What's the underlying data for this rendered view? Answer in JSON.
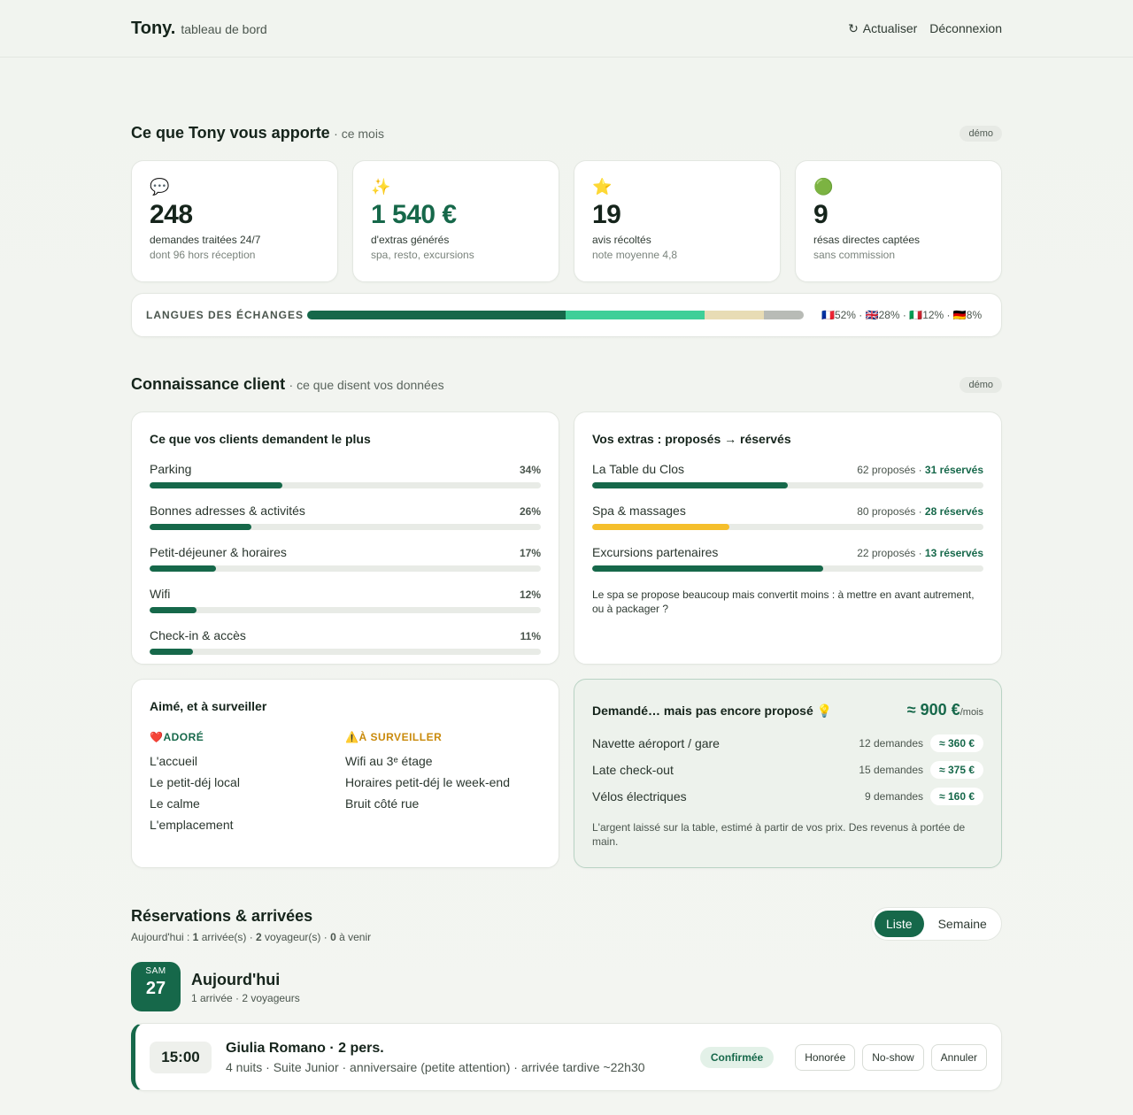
{
  "header": {
    "brand": "Tony.",
    "subtitle": "tableau de bord",
    "refresh": "Actualiser",
    "logout": "Déconnexion"
  },
  "impact": {
    "title": "Ce que Tony vous apporte",
    "subtitle": "· ce mois",
    "badge": "démo",
    "kpis": [
      {
        "emoji": "💬",
        "value": "248",
        "label": "demandes traitées 24/7",
        "note": "dont 96 hors réception"
      },
      {
        "emoji": "✨",
        "value": "1 540 €",
        "label": "d'extras générés",
        "note": "spa, resto, excursions"
      },
      {
        "emoji": "⭐",
        "value": "19",
        "label": "avis récoltés",
        "note": "note moyenne 4,8"
      },
      {
        "emoji": "🟢",
        "value": "9",
        "label": "résas directes captées",
        "note": "sans commission"
      }
    ],
    "languages": {
      "title": "LANGUES DES ÉCHANGES",
      "legend": "🇫🇷52% · 🇬🇧28% · 🇮🇹12% · 🇩🇪8%",
      "shares": [
        52,
        28,
        12,
        8
      ],
      "colors": [
        "#16684a",
        "#3ecf98",
        "#e8dcb5",
        "#b8bbb6"
      ]
    }
  },
  "insight": {
    "title": "Connaissance client",
    "subtitle": "· ce que disent vos données",
    "badge": "démo",
    "requests": {
      "title": "Ce que vos clients demandent le plus",
      "items": [
        {
          "label": "Parking",
          "pct": "34%",
          "value": 34
        },
        {
          "label": "Bonnes adresses & activités",
          "pct": "26%",
          "value": 26
        },
        {
          "label": "Petit-déjeuner & horaires",
          "pct": "17%",
          "value": 17
        },
        {
          "label": "Wifi",
          "pct": "12%",
          "value": 12
        },
        {
          "label": "Check-in & accès",
          "pct": "11%",
          "value": 11
        }
      ]
    },
    "extras": {
      "title": "Vos extras : proposés → réservés",
      "items": [
        {
          "label": "La Table du Clos",
          "offered": "62 proposés · ",
          "booked": "31 réservés",
          "ratio": 0.5,
          "color": "#16684a"
        },
        {
          "label": "Spa & massages",
          "offered": "80 proposés · ",
          "booked": "28 réservés",
          "ratio": 0.35,
          "color": "#f5bf2c"
        },
        {
          "label": "Excursions partenaires",
          "offered": "22 proposés · ",
          "booked": "13 réservés",
          "ratio": 0.59,
          "color": "#16684a"
        }
      ],
      "note": "Le spa se propose beaucoup mais convertit moins : à mettre en avant autrement, ou à packager ?"
    },
    "feedback": {
      "title": "Aimé, et à surveiller",
      "loved_head": "❤️ADORÉ",
      "watch_head": "⚠️À SURVEILLER",
      "loved": [
        "L'accueil",
        "Le petit-déj local",
        "Le calme",
        "L'emplacement"
      ],
      "watch": [
        "Wifi au 3ᵉ étage",
        "Horaires petit-déj le week-end",
        "Bruit côté rue"
      ]
    },
    "missing": {
      "title": "Demandé… mais pas encore proposé 💡",
      "total": "≈ 900 €",
      "total_unit": "/mois",
      "items": [
        {
          "label": "Navette aéroport / gare",
          "count": "12 demandes",
          "amount": "≈ 360 €"
        },
        {
          "label": "Late check-out",
          "count": "15 demandes",
          "amount": "≈ 375 €"
        },
        {
          "label": "Vélos électriques",
          "count": "9 demandes",
          "amount": "≈ 160 €"
        }
      ],
      "note": "L'argent laissé sur la table, estimé à partir de vos prix. Des revenus à portée de main."
    }
  },
  "reservations": {
    "title": "Réservations & arrivées",
    "summary_prefix": "Aujourd'hui : ",
    "arrivals_n": "1",
    "arrivals_t": " arrivée(s) · ",
    "guests_n": "2",
    "guests_t": " voyageur(s) · ",
    "upcoming_n": "0",
    "upcoming_t": " à venir",
    "view_list": "Liste",
    "view_week": "Semaine",
    "day": {
      "dow": "SAM",
      "num": "27",
      "title": "Aujourd'hui",
      "sub": "1 arrivée · 2 voyageurs"
    },
    "booking": {
      "time": "15:00",
      "name": "Giulia Romano · 2 pers.",
      "desc": "4 nuits · Suite Junior · anniversaire (petite attention) · arrivée tardive ~22h30",
      "status": "Confirmée",
      "btn_honored": "Honorée",
      "btn_noshow": "No-show",
      "btn_cancel": "Annuler"
    }
  }
}
